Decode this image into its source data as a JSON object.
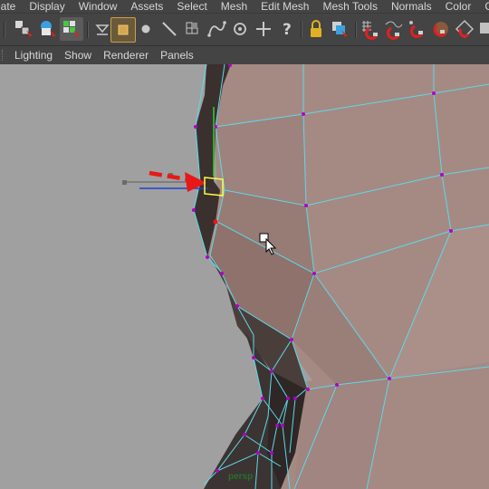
{
  "menubar": {
    "items": [
      "eate",
      "Display",
      "Window",
      "Assets",
      "Select",
      "Mesh",
      "Edit Mesh",
      "Mesh Tools",
      "Normals",
      "Color",
      "Create UVs"
    ]
  },
  "toolbar": {
    "icons": [
      "select-by-hierarchy-icon",
      "select-by-object-icon",
      "select-by-component-icon",
      "filter-menu-icon",
      "select-face-icon",
      "select-vertex-icon",
      "select-edge-icon",
      "select-uv-icon",
      "select-curve-icon",
      "select-point-icon",
      "select-pivot-icon",
      "select-misc-icon",
      "lock-selection-icon",
      "highlight-selection-icon",
      "snap-grid-icon",
      "snap-curve-icon",
      "snap-point-icon",
      "snap-view-plane-icon",
      "snap-live-icon"
    ]
  },
  "panelbar": {
    "items": [
      "Lighting",
      "Show",
      "Renderer",
      "Panels"
    ]
  },
  "viewport": {
    "camera_label": "persp",
    "background_color": "#a0a0a0",
    "mesh_color": "#a58a84",
    "wire_color": "#5fd8e8",
    "vertex_color": "#b000c8",
    "annotation_arrow_color": "#e81818",
    "selected_component_color": "#ffff40"
  }
}
